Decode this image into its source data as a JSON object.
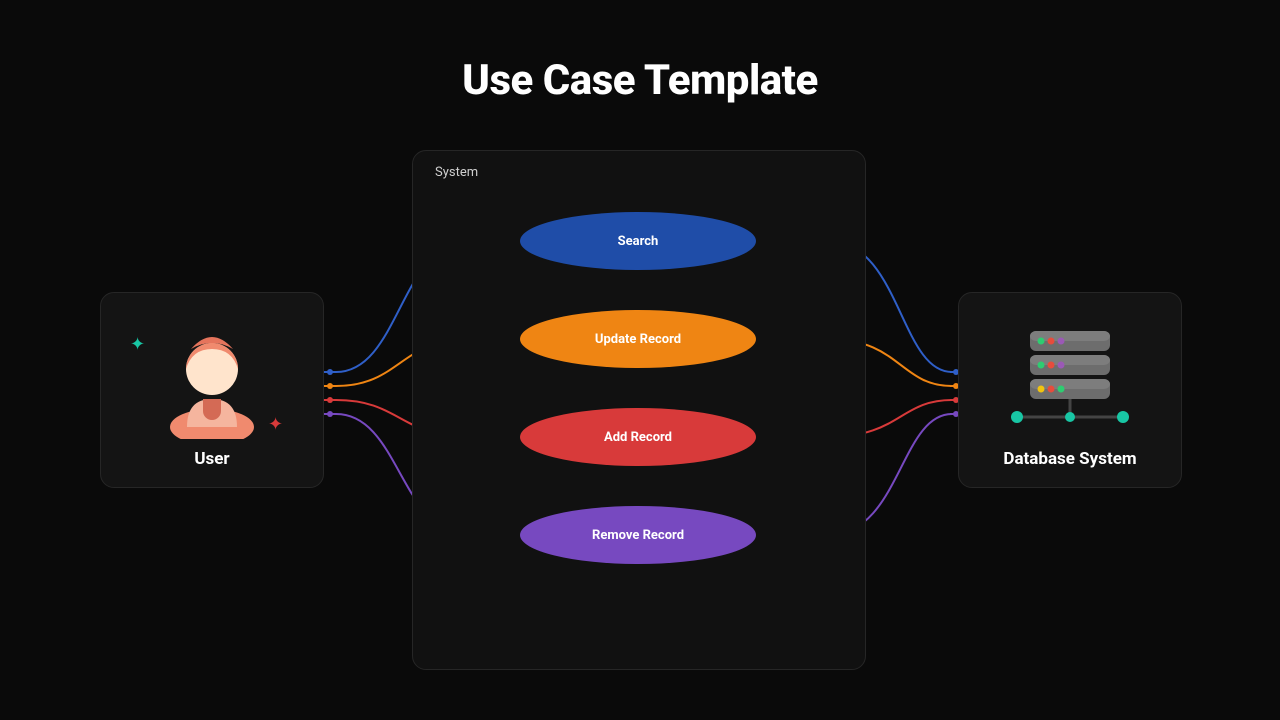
{
  "title": "Use Case Template",
  "actor": {
    "label": "User"
  },
  "system": {
    "label": "System"
  },
  "database": {
    "label": "Database System"
  },
  "usecases": {
    "search": "Search",
    "update": "Update Record",
    "add": "Add Record",
    "remove": "Remove Record"
  },
  "colors": {
    "search": "#2f5fc8",
    "update": "#ef8513",
    "add": "#d83a3a",
    "remove": "#7749c0",
    "accent_teal": "#18c6a4"
  }
}
